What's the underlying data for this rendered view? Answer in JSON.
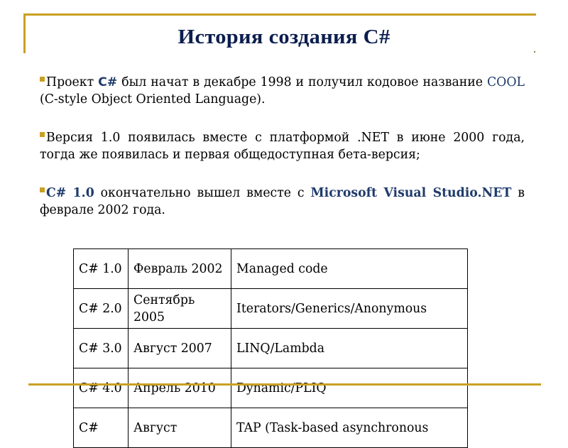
{
  "slide": {
    "title": "История создания C#",
    "colors": {
      "accent": "#C9A023",
      "title": "#0C1E4F",
      "highlight": "#1F3B6B",
      "text": "#000000"
    },
    "bullets": [
      {
        "parts": [
          "Проект ",
          "C#",
          " был начат в декабре 1998 и получил кодовое название ",
          "COOL",
          " (C-style Object Oriented Language)."
        ]
      },
      {
        "text": "Версия 1.0 появилась вместе с платформой .NET в июне 2000 года, тогда же появилась и первая общедоступная бета-версия;"
      },
      {
        "parts": [
          "C# 1.0",
          " окончательно вышел вместе с ",
          "Microsoft Visual Studio.NET",
          " в феврале 2002 года."
        ]
      }
    ],
    "table": {
      "rows": [
        {
          "version": "C# 1.0",
          "date": "Февраль 2002",
          "features": "Managed code"
        },
        {
          "version": "C# 2.0",
          "date": "Сентябрь 2005",
          "features": "Iterators/Generics/Anonymous"
        },
        {
          "version": "C# 3.0",
          "date": "Август 2007",
          "features": "LINQ/Lambda"
        },
        {
          "version": "C# 4.0",
          "date": "Апрель 2010",
          "features": "Dynamic/PLIQ"
        },
        {
          "version": "C#",
          "date": "Август",
          "features": "TAP (Task-based asynchronous"
        }
      ]
    }
  }
}
